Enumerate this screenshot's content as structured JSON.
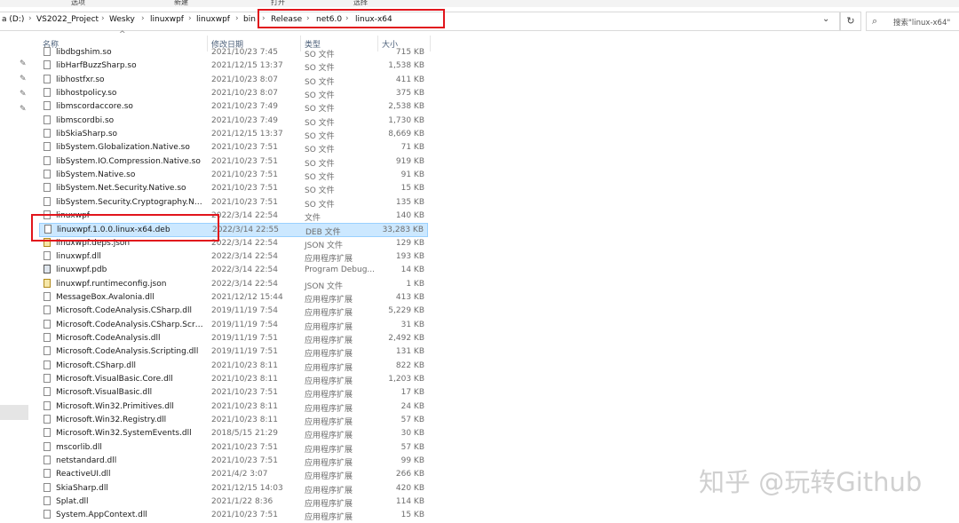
{
  "ribbon": {
    "labels": [
      "选项",
      "新建",
      "打开",
      "选择"
    ]
  },
  "address": {
    "crumbs": [
      "a (D:)",
      "VS2022_Project",
      "Wesky",
      "linuxwpf",
      "linuxwpf",
      "bin",
      "Release",
      "net6.0",
      "linux-x64"
    ],
    "search_placeholder": "搜索\"linux-x64\""
  },
  "columns": {
    "name": "名称",
    "date": "修改日期",
    "type": "类型",
    "size": "大小"
  },
  "files": [
    {
      "name": "libdbgshim.so",
      "date": "2021/10/23 7:45",
      "type": "SO 文件",
      "size": "715 KB",
      "icon": "file-icon"
    },
    {
      "name": "libHarfBuzzSharp.so",
      "date": "2021/12/15 13:37",
      "type": "SO 文件",
      "size": "1,538 KB",
      "icon": "file-icon"
    },
    {
      "name": "libhostfxr.so",
      "date": "2021/10/23 8:07",
      "type": "SO 文件",
      "size": "411 KB",
      "icon": "file-icon"
    },
    {
      "name": "libhostpolicy.so",
      "date": "2021/10/23 8:07",
      "type": "SO 文件",
      "size": "375 KB",
      "icon": "file-icon"
    },
    {
      "name": "libmscordaccore.so",
      "date": "2021/10/23 7:49",
      "type": "SO 文件",
      "size": "2,538 KB",
      "icon": "file-icon"
    },
    {
      "name": "libmscordbi.so",
      "date": "2021/10/23 7:49",
      "type": "SO 文件",
      "size": "1,730 KB",
      "icon": "file-icon"
    },
    {
      "name": "libSkiaSharp.so",
      "date": "2021/12/15 13:37",
      "type": "SO 文件",
      "size": "8,669 KB",
      "icon": "file-icon"
    },
    {
      "name": "libSystem.Globalization.Native.so",
      "date": "2021/10/23 7:51",
      "type": "SO 文件",
      "size": "71 KB",
      "icon": "file-icon"
    },
    {
      "name": "libSystem.IO.Compression.Native.so",
      "date": "2021/10/23 7:51",
      "type": "SO 文件",
      "size": "919 KB",
      "icon": "file-icon"
    },
    {
      "name": "libSystem.Native.so",
      "date": "2021/10/23 7:51",
      "type": "SO 文件",
      "size": "91 KB",
      "icon": "file-icon"
    },
    {
      "name": "libSystem.Net.Security.Native.so",
      "date": "2021/10/23 7:51",
      "type": "SO 文件",
      "size": "15 KB",
      "icon": "file-icon"
    },
    {
      "name": "libSystem.Security.Cryptography.Nati...",
      "date": "2021/10/23 7:51",
      "type": "SO 文件",
      "size": "135 KB",
      "icon": "file-icon"
    },
    {
      "name": "linuxwpf",
      "date": "2022/3/14 22:54",
      "type": "文件",
      "size": "140 KB",
      "icon": "file-icon"
    },
    {
      "name": "linuxwpf.1.0.0.linux-x64.deb",
      "date": "2022/3/14 22:55",
      "type": "DEB 文件",
      "size": "33,283 KB",
      "icon": "deb-file-icon",
      "selected": true
    },
    {
      "name": "linuxwpf.deps.json",
      "date": "2022/3/14 22:54",
      "type": "JSON 文件",
      "size": "129 KB",
      "icon": "json-file-icon"
    },
    {
      "name": "linuxwpf.dll",
      "date": "2022/3/14 22:54",
      "type": "应用程序扩展",
      "size": "193 KB",
      "icon": "dll-file-icon"
    },
    {
      "name": "linuxwpf.pdb",
      "date": "2022/3/14 22:54",
      "type": "Program Debug...",
      "size": "14 KB",
      "icon": "pdb-file-icon"
    },
    {
      "name": "linuxwpf.runtimeconfig.json",
      "date": "2022/3/14 22:54",
      "type": "JSON 文件",
      "size": "1 KB",
      "icon": "json-file-icon"
    },
    {
      "name": "MessageBox.Avalonia.dll",
      "date": "2021/12/12 15:44",
      "type": "应用程序扩展",
      "size": "413 KB",
      "icon": "dll-file-icon"
    },
    {
      "name": "Microsoft.CodeAnalysis.CSharp.dll",
      "date": "2019/11/19 7:54",
      "type": "应用程序扩展",
      "size": "5,229 KB",
      "icon": "dll-file-icon"
    },
    {
      "name": "Microsoft.CodeAnalysis.CSharp.Script...",
      "date": "2019/11/19 7:54",
      "type": "应用程序扩展",
      "size": "31 KB",
      "icon": "dll-file-icon"
    },
    {
      "name": "Microsoft.CodeAnalysis.dll",
      "date": "2019/11/19 7:51",
      "type": "应用程序扩展",
      "size": "2,492 KB",
      "icon": "dll-file-icon"
    },
    {
      "name": "Microsoft.CodeAnalysis.Scripting.dll",
      "date": "2019/11/19 7:51",
      "type": "应用程序扩展",
      "size": "131 KB",
      "icon": "dll-file-icon"
    },
    {
      "name": "Microsoft.CSharp.dll",
      "date": "2021/10/23 8:11",
      "type": "应用程序扩展",
      "size": "822 KB",
      "icon": "dll-file-icon"
    },
    {
      "name": "Microsoft.VisualBasic.Core.dll",
      "date": "2021/10/23 8:11",
      "type": "应用程序扩展",
      "size": "1,203 KB",
      "icon": "dll-file-icon"
    },
    {
      "name": "Microsoft.VisualBasic.dll",
      "date": "2021/10/23 7:51",
      "type": "应用程序扩展",
      "size": "17 KB",
      "icon": "dll-file-icon"
    },
    {
      "name": "Microsoft.Win32.Primitives.dll",
      "date": "2021/10/23 8:11",
      "type": "应用程序扩展",
      "size": "24 KB",
      "icon": "dll-file-icon"
    },
    {
      "name": "Microsoft.Win32.Registry.dll",
      "date": "2021/10/23 8:11",
      "type": "应用程序扩展",
      "size": "57 KB",
      "icon": "dll-file-icon"
    },
    {
      "name": "Microsoft.Win32.SystemEvents.dll",
      "date": "2018/5/15 21:29",
      "type": "应用程序扩展",
      "size": "30 KB",
      "icon": "dll-file-icon"
    },
    {
      "name": "mscorlib.dll",
      "date": "2021/10/23 7:51",
      "type": "应用程序扩展",
      "size": "57 KB",
      "icon": "dll-file-icon"
    },
    {
      "name": "netstandard.dll",
      "date": "2021/10/23 7:51",
      "type": "应用程序扩展",
      "size": "99 KB",
      "icon": "dll-file-icon"
    },
    {
      "name": "ReactiveUI.dll",
      "date": "2021/4/2 3:07",
      "type": "应用程序扩展",
      "size": "266 KB",
      "icon": "dll-file-icon"
    },
    {
      "name": "SkiaSharp.dll",
      "date": "2021/12/15 14:03",
      "type": "应用程序扩展",
      "size": "420 KB",
      "icon": "dll-file-icon"
    },
    {
      "name": "Splat.dll",
      "date": "2021/1/22 8:36",
      "type": "应用程序扩展",
      "size": "114 KB",
      "icon": "dll-file-icon"
    },
    {
      "name": "System.AppContext.dll",
      "date": "2021/10/23 7:51",
      "type": "应用程序扩展",
      "size": "15 KB",
      "icon": "dll-file-icon"
    }
  ],
  "watermark": "知乎 @玩转Github",
  "colors": {
    "highlight": "#e1151c",
    "selection": "#cce8ff"
  }
}
